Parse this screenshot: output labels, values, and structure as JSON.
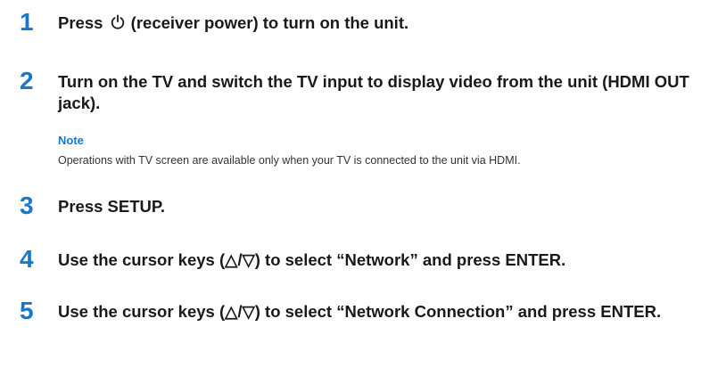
{
  "steps": [
    {
      "number": "1",
      "text_before_icon": "Press ",
      "icon": "power-icon",
      "text_after_icon": " (receiver power) to turn on the unit."
    },
    {
      "number": "2",
      "text": "Turn on the TV and switch the TV input to display video from the unit (HDMI OUT jack)."
    },
    {
      "number": "3",
      "text": "Press SETUP."
    },
    {
      "number": "4",
      "text": "Use the cursor keys (△/▽) to select “Network” and press ENTER."
    },
    {
      "number": "5",
      "text": "Use the cursor keys (△/▽) to select “Network Connection” and press ENTER."
    }
  ],
  "note": {
    "title": "Note",
    "body": "Operations with TV screen are available only when your TV is connected to the unit via HDMI."
  },
  "colors": {
    "accent": "#1a78c8",
    "text": "#1a1a1a"
  }
}
